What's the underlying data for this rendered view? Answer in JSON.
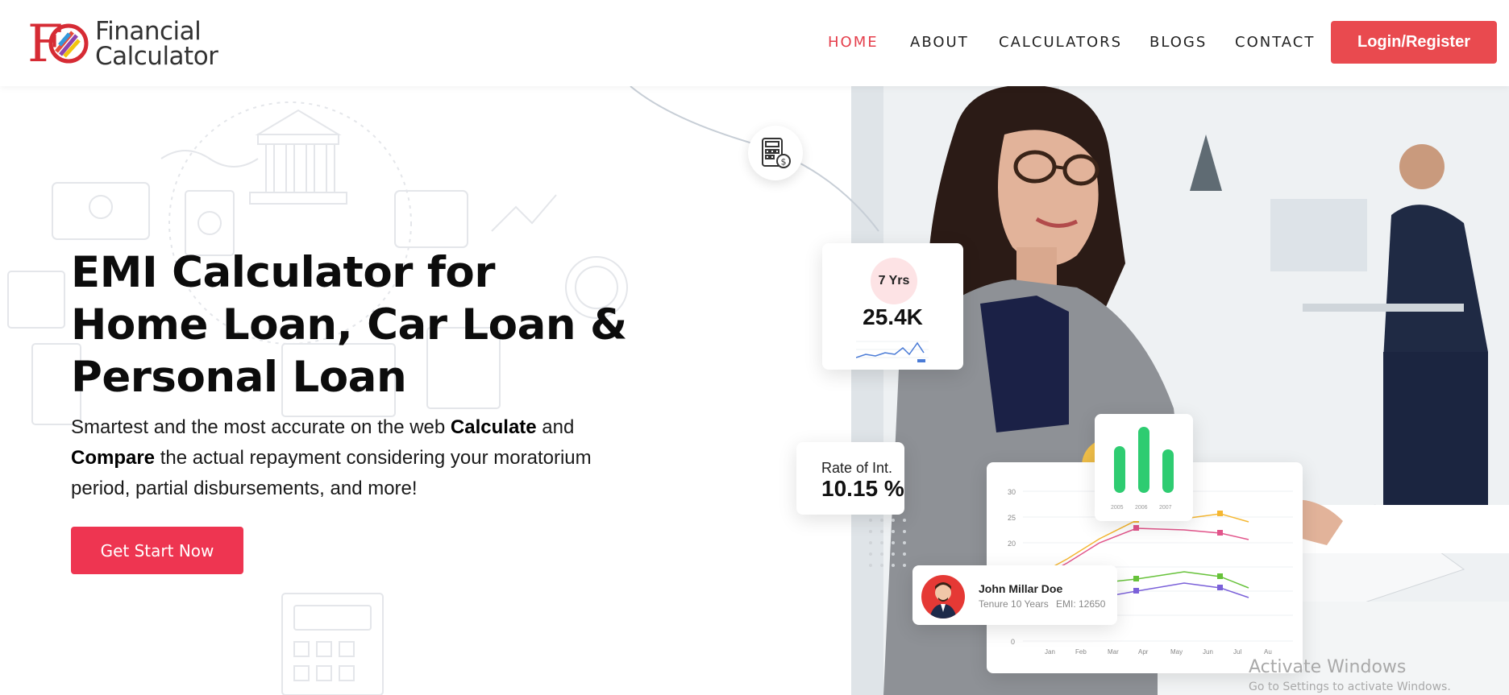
{
  "brand": {
    "logo_text_line1": "Financial",
    "logo_text_line2": "Calculator",
    "mark_letters": "FC",
    "accent_color": "#e94a4f"
  },
  "nav": {
    "items": [
      {
        "label": "HOME",
        "active": true
      },
      {
        "label": "ABOUT",
        "active": false
      },
      {
        "label": "CALCULATORS",
        "active": false
      },
      {
        "label": "BLOGS",
        "active": false
      },
      {
        "label": "CONTACT",
        "active": false
      }
    ],
    "login_label": "Login/Register"
  },
  "hero": {
    "title_line1": "EMI Calculator for",
    "title_line2": "Home Loan, Car Loan &",
    "title_line3": "Personal Loan",
    "desc_part1": "Smartest and the most accurate on the web ",
    "desc_bold1": "Calculate",
    "desc_part2": " and",
    "desc_bold2": "Compare",
    "desc_part3": " the actual repayment considering your moratorium period, partial disbursements, and more!",
    "cta_label": "Get Start Now",
    "cta_color": "#ee3551"
  },
  "cards": {
    "tenure_badge": "7 Yrs",
    "tenure_value": "25.4K",
    "rate_label": "Rate of Int.",
    "rate_value": "10.15 %",
    "bar_years": [
      "2005",
      "2006",
      "2007"
    ],
    "bar_values": [
      0.55,
      0.95,
      0.5
    ],
    "bar_color": "#2ecc71",
    "line_chart": {
      "y_ticks": [
        "30",
        "25",
        "20",
        "0"
      ],
      "months": [
        "Jan",
        "Feb",
        "Mar",
        "Apr",
        "May",
        "Jun",
        "Jul",
        "Au"
      ]
    },
    "user_name": "John Millar Doe",
    "user_tenure": "Tenure 10 Years",
    "user_emi": "EMI: 12650"
  },
  "watermark": {
    "line1": "Activate Windows",
    "line2": "Go to Settings to activate Windows."
  }
}
